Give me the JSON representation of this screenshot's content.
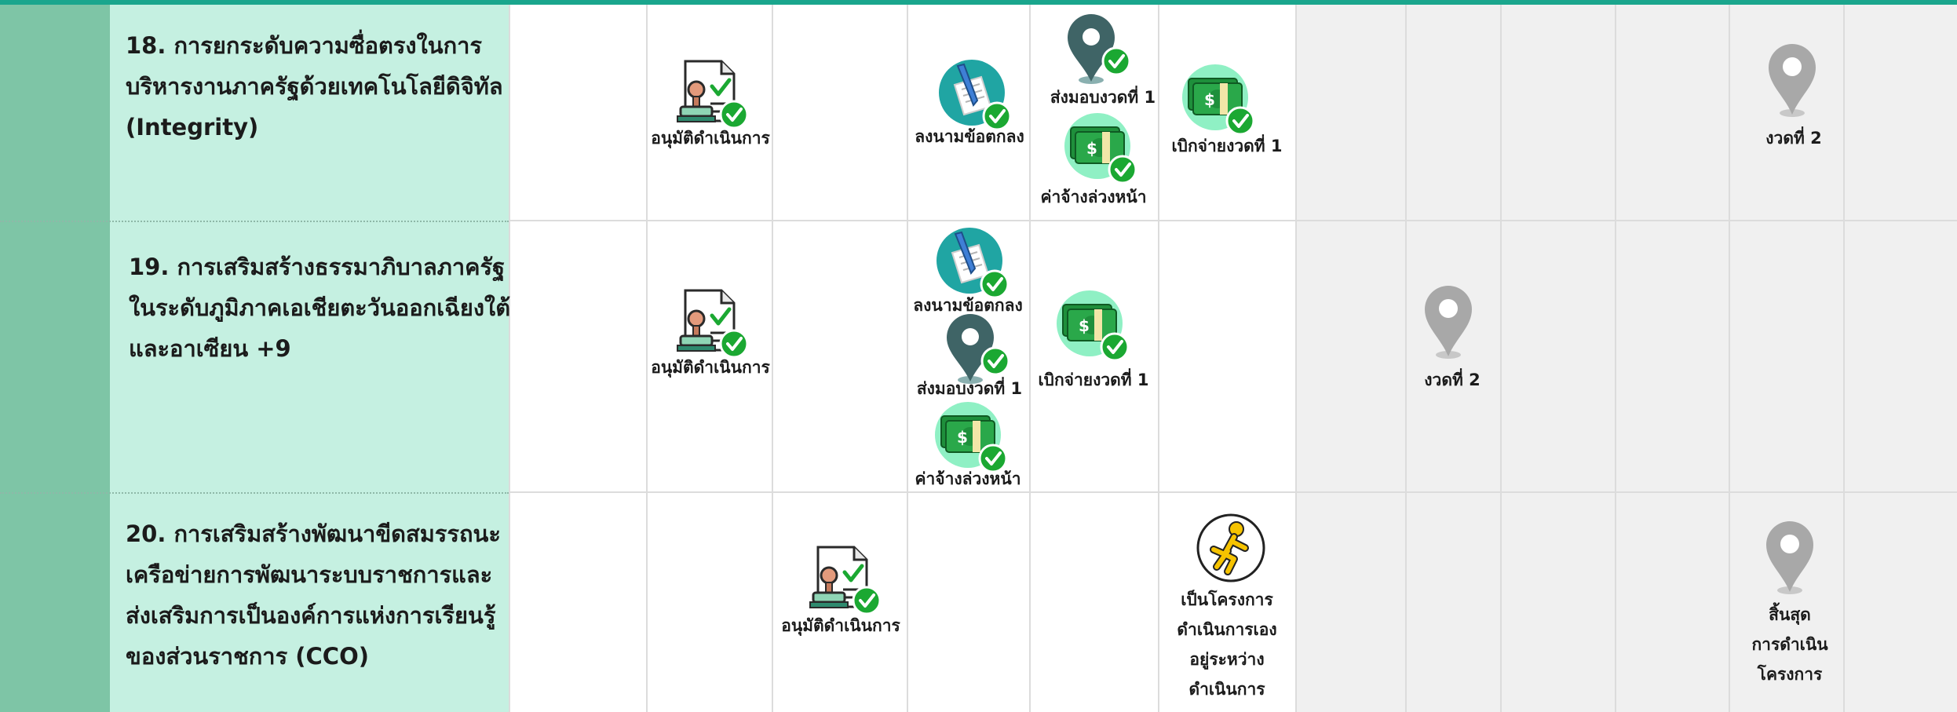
{
  "colors": {
    "accent_bar": "#1aa68d",
    "label_column": "#7ec5a6",
    "title_column": "#c5f0e1",
    "future_cells": "#f0f0f0",
    "check": "#1ba832",
    "pin_active": "#3f6466",
    "pin_future": "#a8a8a8"
  },
  "projects": [
    {
      "title_lines": [
        "18. การยกระดับความซื่อตรงในการ",
        "บริหารงานภาครัฐด้วยเทคโนโลยีดิจิทัล",
        "(Integrity)"
      ],
      "milestones": {
        "approve": {
          "icon": "approval-document-icon",
          "label": "อนุมัติดำเนินการ"
        },
        "sign": {
          "icon": "contract-sign-icon",
          "label": "ลงนามข้อตกลง"
        },
        "deliver": {
          "icon": "location-pin-icon",
          "label": "ส่งมอบงวดที่ 1"
        },
        "advance": {
          "icon": "money-icon",
          "label": "ค่าจ้างล่วงหน้า"
        },
        "disburse": {
          "icon": "money-icon",
          "label": "เบิกจ่ายงวดที่ 1"
        },
        "next": {
          "icon": "location-pin-icon",
          "label": "งวดที่ 2"
        }
      }
    },
    {
      "title_lines": [
        "19. การเสริมสร้างธรรมาภิบาลภาครัฐ",
        "ในระดับภูมิภาคเอเชียตะวันออกเฉียงใต้",
        "และอาเซียน +9"
      ],
      "milestones": {
        "approve": {
          "icon": "approval-document-icon",
          "label": "อนุมัติดำเนินการ"
        },
        "sign": {
          "icon": "contract-sign-icon",
          "label": "ลงนามข้อตกลง"
        },
        "deliver": {
          "icon": "location-pin-icon",
          "label": "ส่งมอบงวดที่ 1"
        },
        "advance": {
          "icon": "money-icon",
          "label": "ค่าจ้างล่วงหน้า"
        },
        "disburse": {
          "icon": "money-icon",
          "label": "เบิกจ่ายงวดที่ 1"
        },
        "next": {
          "icon": "location-pin-icon",
          "label": "งวดที่ 2"
        }
      }
    },
    {
      "title_lines": [
        "20. การเสริมสร้างพัฒนาขีดสมรรถนะ",
        "เครือข่ายการพัฒนาระบบราชการและ",
        "ส่งเสริมการเป็นองค์การแห่งการเรียนรู้",
        "ของส่วนราชการ (CCO)"
      ],
      "milestones": {
        "approve": {
          "icon": "approval-document-icon",
          "label": "อนุมัติดำเนินการ"
        },
        "inprogress": {
          "icon": "running-person-icon",
          "label_lines": [
            "เป็นโครงการ",
            "ดำเนินการเอง",
            "อยู่ระหว่าง",
            "ดำเนินการ"
          ]
        },
        "end": {
          "icon": "location-pin-icon",
          "label_lines": [
            "สิ้นสุด",
            "การดำเนิน",
            "โครงการ"
          ]
        }
      }
    }
  ]
}
